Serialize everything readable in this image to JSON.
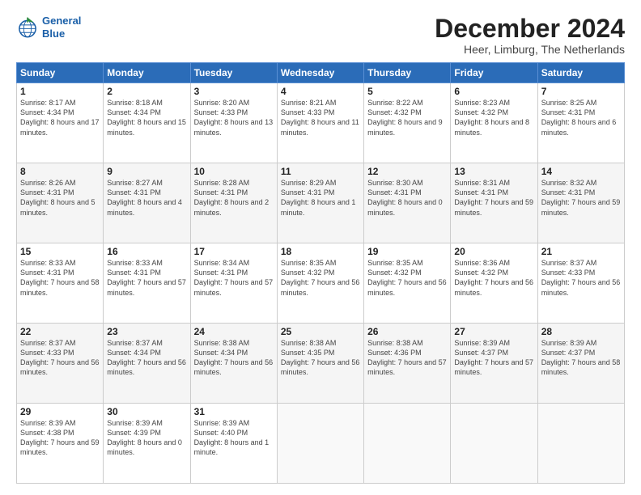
{
  "logo": {
    "line1": "General",
    "line2": "Blue"
  },
  "title": "December 2024",
  "subtitle": "Heer, Limburg, The Netherlands",
  "days_of_week": [
    "Sunday",
    "Monday",
    "Tuesday",
    "Wednesday",
    "Thursday",
    "Friday",
    "Saturday"
  ],
  "weeks": [
    [
      {
        "day": "1",
        "sunrise": "8:17 AM",
        "sunset": "4:34 PM",
        "daylight": "8 hours and 17 minutes."
      },
      {
        "day": "2",
        "sunrise": "8:18 AM",
        "sunset": "4:34 PM",
        "daylight": "8 hours and 15 minutes."
      },
      {
        "day": "3",
        "sunrise": "8:20 AM",
        "sunset": "4:33 PM",
        "daylight": "8 hours and 13 minutes."
      },
      {
        "day": "4",
        "sunrise": "8:21 AM",
        "sunset": "4:33 PM",
        "daylight": "8 hours and 11 minutes."
      },
      {
        "day": "5",
        "sunrise": "8:22 AM",
        "sunset": "4:32 PM",
        "daylight": "8 hours and 9 minutes."
      },
      {
        "day": "6",
        "sunrise": "8:23 AM",
        "sunset": "4:32 PM",
        "daylight": "8 hours and 8 minutes."
      },
      {
        "day": "7",
        "sunrise": "8:25 AM",
        "sunset": "4:31 PM",
        "daylight": "8 hours and 6 minutes."
      }
    ],
    [
      {
        "day": "8",
        "sunrise": "8:26 AM",
        "sunset": "4:31 PM",
        "daylight": "8 hours and 5 minutes."
      },
      {
        "day": "9",
        "sunrise": "8:27 AM",
        "sunset": "4:31 PM",
        "daylight": "8 hours and 4 minutes."
      },
      {
        "day": "10",
        "sunrise": "8:28 AM",
        "sunset": "4:31 PM",
        "daylight": "8 hours and 2 minutes."
      },
      {
        "day": "11",
        "sunrise": "8:29 AM",
        "sunset": "4:31 PM",
        "daylight": "8 hours and 1 minute."
      },
      {
        "day": "12",
        "sunrise": "8:30 AM",
        "sunset": "4:31 PM",
        "daylight": "8 hours and 0 minutes."
      },
      {
        "day": "13",
        "sunrise": "8:31 AM",
        "sunset": "4:31 PM",
        "daylight": "7 hours and 59 minutes."
      },
      {
        "day": "14",
        "sunrise": "8:32 AM",
        "sunset": "4:31 PM",
        "daylight": "7 hours and 59 minutes."
      }
    ],
    [
      {
        "day": "15",
        "sunrise": "8:33 AM",
        "sunset": "4:31 PM",
        "daylight": "7 hours and 58 minutes."
      },
      {
        "day": "16",
        "sunrise": "8:33 AM",
        "sunset": "4:31 PM",
        "daylight": "7 hours and 57 minutes."
      },
      {
        "day": "17",
        "sunrise": "8:34 AM",
        "sunset": "4:31 PM",
        "daylight": "7 hours and 57 minutes."
      },
      {
        "day": "18",
        "sunrise": "8:35 AM",
        "sunset": "4:32 PM",
        "daylight": "7 hours and 56 minutes."
      },
      {
        "day": "19",
        "sunrise": "8:35 AM",
        "sunset": "4:32 PM",
        "daylight": "7 hours and 56 minutes."
      },
      {
        "day": "20",
        "sunrise": "8:36 AM",
        "sunset": "4:32 PM",
        "daylight": "7 hours and 56 minutes."
      },
      {
        "day": "21",
        "sunrise": "8:37 AM",
        "sunset": "4:33 PM",
        "daylight": "7 hours and 56 minutes."
      }
    ],
    [
      {
        "day": "22",
        "sunrise": "8:37 AM",
        "sunset": "4:33 PM",
        "daylight": "7 hours and 56 minutes."
      },
      {
        "day": "23",
        "sunrise": "8:37 AM",
        "sunset": "4:34 PM",
        "daylight": "7 hours and 56 minutes."
      },
      {
        "day": "24",
        "sunrise": "8:38 AM",
        "sunset": "4:34 PM",
        "daylight": "7 hours and 56 minutes."
      },
      {
        "day": "25",
        "sunrise": "8:38 AM",
        "sunset": "4:35 PM",
        "daylight": "7 hours and 56 minutes."
      },
      {
        "day": "26",
        "sunrise": "8:38 AM",
        "sunset": "4:36 PM",
        "daylight": "7 hours and 57 minutes."
      },
      {
        "day": "27",
        "sunrise": "8:39 AM",
        "sunset": "4:37 PM",
        "daylight": "7 hours and 57 minutes."
      },
      {
        "day": "28",
        "sunrise": "8:39 AM",
        "sunset": "4:37 PM",
        "daylight": "7 hours and 58 minutes."
      }
    ],
    [
      {
        "day": "29",
        "sunrise": "8:39 AM",
        "sunset": "4:38 PM",
        "daylight": "7 hours and 59 minutes."
      },
      {
        "day": "30",
        "sunrise": "8:39 AM",
        "sunset": "4:39 PM",
        "daylight": "8 hours and 0 minutes."
      },
      {
        "day": "31",
        "sunrise": "8:39 AM",
        "sunset": "4:40 PM",
        "daylight": "8 hours and 1 minute."
      },
      null,
      null,
      null,
      null
    ]
  ],
  "labels": {
    "sunrise": "Sunrise:",
    "sunset": "Sunset:",
    "daylight": "Daylight:"
  }
}
